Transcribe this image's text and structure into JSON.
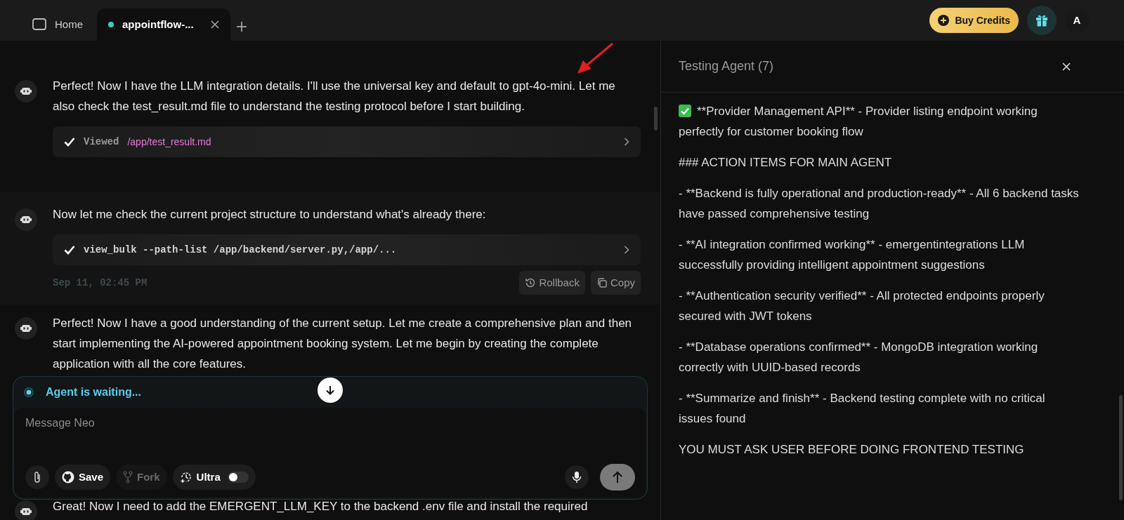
{
  "tabs": [
    {
      "kind": "home",
      "label": "Home",
      "selected": false
    },
    {
      "kind": "project",
      "label": "appointflow-...",
      "selected": true
    }
  ],
  "header": {
    "buy_credits": "Buy Credits",
    "avatar": "A"
  },
  "messages": [
    {
      "text": "Perfect! Now I have the LLM integration details. I'll use the universal key and default to gpt-4o-mini. Let me also check the test_result.md file to understand the testing protocol before I start building.",
      "highlighted": false,
      "tool": {
        "label": "Viewed",
        "path": "/app/test_result.md"
      }
    },
    {
      "text": "Now let me check the current project structure to understand what's already there:",
      "highlighted": true,
      "tool": {
        "label": "view_bulk --path-list /app/backend/server.py,/app/..."
      },
      "timestamp": "Sep 11, 02:45 PM",
      "actions": [
        {
          "kind": "rollback",
          "label": "Rollback"
        },
        {
          "kind": "copy",
          "label": "Copy"
        }
      ]
    },
    {
      "text": "Perfect! Now I have a good understanding of the current setup. Let me create a comprehensive plan and then start implementing the AI-powered appointment booking system. Let me begin by creating the complete application with all the core features.",
      "highlighted": false
    },
    {
      "text": "Great! Now I need to add the EMERGENT_LLM_KEY to the backend .env file and install the required",
      "highlighted": false
    }
  ],
  "composer": {
    "status": "Agent is waiting...",
    "placeholder": "Message Neo",
    "tools": [
      {
        "kind": "attach"
      },
      {
        "kind": "save",
        "label": "Save",
        "disabled": false
      },
      {
        "kind": "fork",
        "label": "Fork",
        "disabled": true
      },
      {
        "kind": "ultra",
        "label": "Ultra",
        "on": false
      }
    ]
  },
  "panel": {
    "title": "Testing Agent (7)",
    "paragraphs": [
      {
        "kind": "check",
        "text": "**Provider Management API** - Provider listing endpoint working perfectly for customer booking flow"
      },
      {
        "kind": "text",
        "text": "### ACTION ITEMS FOR MAIN AGENT"
      },
      {
        "kind": "text",
        "text": "- **Backend is fully operational and production-ready** - All 6 backend tasks have passed comprehensive testing"
      },
      {
        "kind": "text",
        "text": "- **AI integration confirmed working** - emergentintegrations LLM successfully providing intelligent appointment suggestions"
      },
      {
        "kind": "text",
        "text": "- **Authentication security verified** - All protected endpoints properly secured with JWT tokens"
      },
      {
        "kind": "text",
        "text": "- **Database operations confirmed** - MongoDB integration working correctly with UUID-based records"
      },
      {
        "kind": "text",
        "text": "- **Summarize and finish** - Backend testing complete with no critical issues found"
      },
      {
        "kind": "text",
        "text": "YOU MUST ASK USER BEFORE DOING FRONTEND TESTING"
      }
    ]
  }
}
